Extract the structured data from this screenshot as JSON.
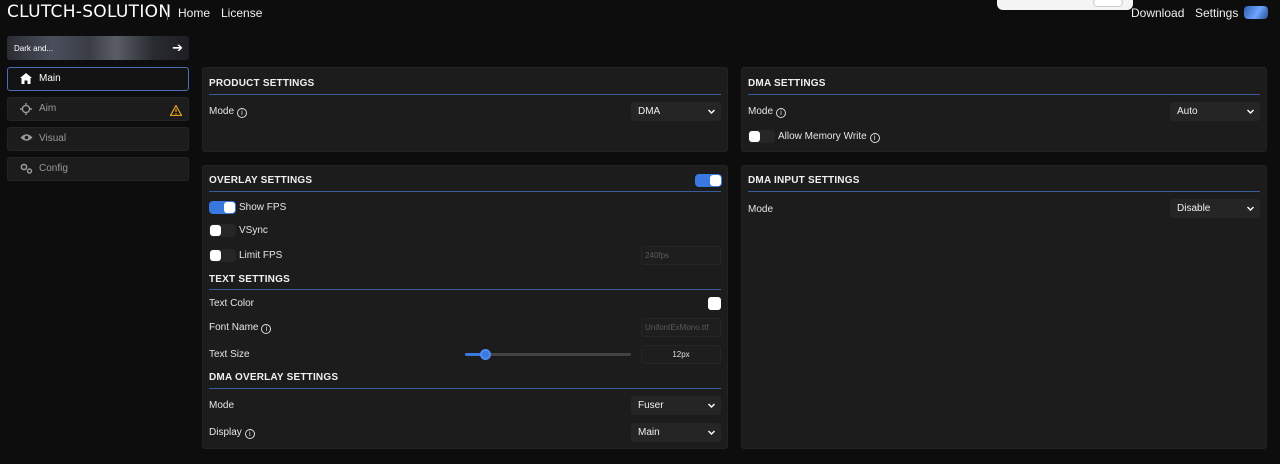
{
  "app": {
    "brand": "CLUTCH-SOLUTION"
  },
  "topnav": {
    "home": "Home",
    "license": "License",
    "download": "Download",
    "settings": "Settings"
  },
  "sidebar": {
    "banner_label": "Dark and...",
    "items": [
      {
        "label": "Main",
        "icon": "home-icon",
        "active": true
      },
      {
        "label": "Aim",
        "icon": "crosshair-icon",
        "warning": true
      },
      {
        "label": "Visual",
        "icon": "eye-icon"
      },
      {
        "label": "Config",
        "icon": "gears-icon"
      }
    ]
  },
  "product_settings": {
    "title": "PRODUCT SETTINGS",
    "mode_label": "Mode",
    "mode_value": "DMA"
  },
  "dma_settings": {
    "title": "DMA SETTINGS",
    "mode_label": "Mode",
    "mode_value": "Auto",
    "allow_memory_write_label": "Allow Memory Write",
    "allow_memory_write": false
  },
  "overlay_settings": {
    "title": "OVERLAY SETTINGS",
    "enabled": true,
    "show_fps_label": "Show FPS",
    "show_fps": true,
    "vsync_label": "VSync",
    "vsync": false,
    "limit_fps_label": "Limit FPS",
    "limit_fps": false,
    "limit_fps_placeholder": "240fps"
  },
  "text_settings": {
    "title": "TEXT SETTINGS",
    "text_color_label": "Text Color",
    "text_color": "#ffffff",
    "font_name_label": "Font Name",
    "font_name_placeholder": "UnifontExMono.ttf",
    "text_size_label": "Text Size",
    "text_size_value": "12px",
    "text_size_fraction": 0.12
  },
  "dma_overlay_settings": {
    "title": "DMA OVERLAY SETTINGS",
    "mode_label": "Mode",
    "mode_value": "Fuser",
    "display_label": "Display",
    "display_value": "Main"
  },
  "dma_input_settings": {
    "title": "DMA INPUT SETTINGS",
    "mode_label": "Mode",
    "mode_value": "Disable"
  },
  "colors": {
    "accent": "#3a78e0",
    "warning": "#e8a317",
    "rule": "#3b5c9a"
  }
}
